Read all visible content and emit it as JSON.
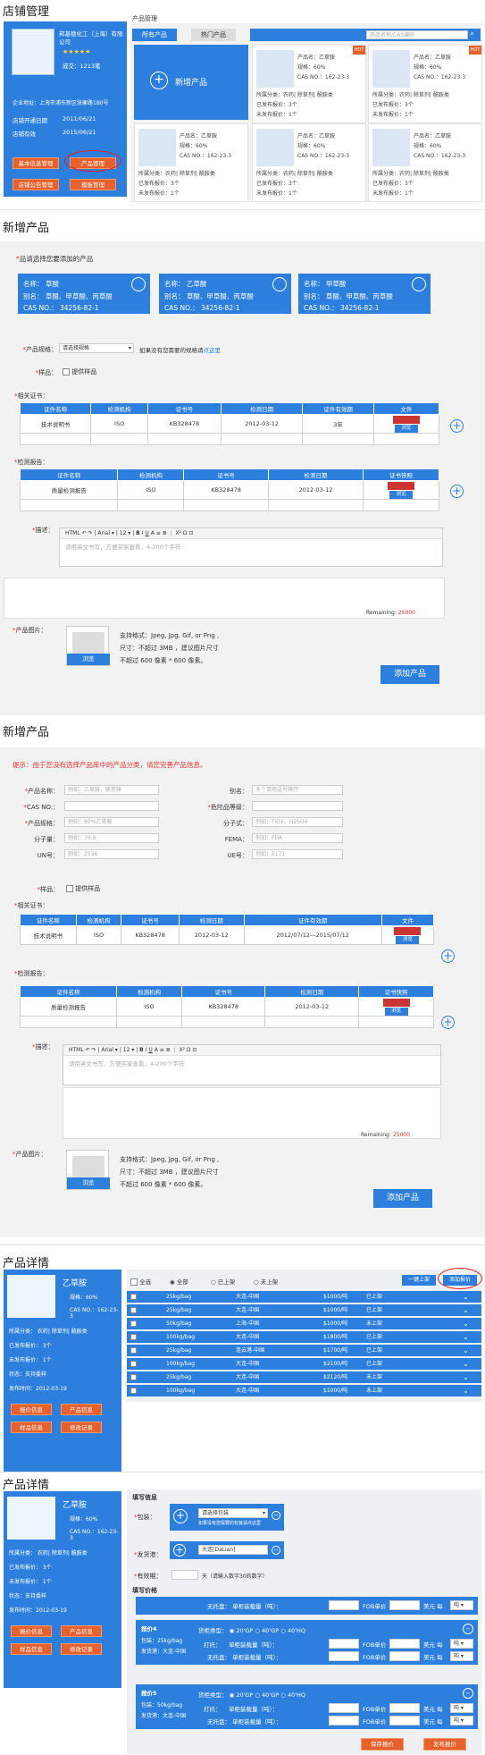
{
  "store": {
    "title": "店铺管理",
    "company": "邦基德化工（上海）有限公司",
    "stars": "★★★★★",
    "deals": "成交：1213笔",
    "address": "企业地址：上海市浦东新区张衡路180号",
    "open_label": "店铺开通日期",
    "open_date": "2011/06/21",
    "expire_label": "店铺有效",
    "expire_date": "2015/06/21",
    "btn_basic": "基本信息管理",
    "btn_product": "产品管理",
    "btn_notice": "店铺公告管理",
    "btn_template": "模板管理"
  },
  "product_mgmt": {
    "title": "产品管理",
    "tab_all": "所有产品",
    "tab_hot": "热门产品",
    "search_placeholder": "商品名称/CAS编码",
    "add_label": "新增产品",
    "hot": "HOT",
    "items": [
      {
        "name": "产品名：乙草胺",
        "spec": "规格：60%",
        "cas": "CAS NO.：162-23-3",
        "cat": "所属分类：农药| 除草剂| 酰胺类",
        "pub": "已发布报价：3个",
        "unpub": "未发布报价：1个"
      },
      {
        "name": "产品名：乙草胺",
        "spec": "规格：60%",
        "cas": "CAS NO.：162-23-3",
        "cat": "所属分类：农药| 除草剂| 酰胺类",
        "pub": "已发布报价：3个",
        "unpub": "未发布报价：1个"
      },
      {
        "name": "产品名：乙草胺",
        "spec": "规格：60%",
        "cas": "CAS NO.：162-23-3",
        "cat": "所属分类：农药| 除草剂| 酰胺类",
        "pub": "已发布报价：3个",
        "unpub": "未发布报价：1个"
      },
      {
        "name": "产品名：乙草胺",
        "spec": "规格：60%",
        "cas": "CAS NO.：162-23-3",
        "cat": "所属分类：农药| 除草剂| 酰胺类",
        "pub": "已发布报价：3个",
        "unpub": "未发布报价：1个"
      },
      {
        "name": "产品名：乙草胺",
        "spec": "规格：60%",
        "cas": "CAS NO.：162-23-3",
        "cat": "所属分类：农药| 除草剂| 酰胺类",
        "pub": "已发布报价：3个",
        "unpub": "未发布报价：1个"
      }
    ]
  },
  "new1": {
    "title": "新增产品",
    "choose": "品请选择您要添加的产品",
    "cards": [
      {
        "name": "名称：   草酸",
        "alias": "别名：   草酸、甲草酸、丙草酸",
        "cas": "CAS NO.：  34256-82-1"
      },
      {
        "name": "名称：   乙草酸",
        "alias": "别名：   草酸、甲草酸、丙草酸",
        "cas": "CAS NO.：  34256-82-1"
      },
      {
        "name": "名称：   甲草酸",
        "alias": "别名：   草酸、甲草酸、丙草酸",
        "cas": "CAS NO.：  34256-82-1"
      }
    ],
    "spec_label": "产品规格：",
    "spec_value": "请选择规格",
    "spec_hint": "如果没有您需要的规格请",
    "spec_link": "点这里",
    "sample_label": "样品：",
    "sample_text": "提供样品",
    "cert_label": "相关证书：",
    "report_label": "检测报告：",
    "desc_label": "描述：",
    "desc_placeholder": "请用英文书写，方便买家查看，4-200个字符",
    "remaining_label": "Remaining:",
    "remaining_value": "25000",
    "image_label": "产品图片：",
    "img_hint1": "支持格式：Jpeg, Jpg, Gif, or Png ,",
    "img_hint2": "尺寸：不超过 3MB ，建议图片尺寸",
    "img_hint3": "不超过 600 像素 * 600 像素。",
    "browse": "浏览",
    "add_btn": "添加产品"
  },
  "cert_table": {
    "headers": [
      "证件名称",
      "检测机构",
      "证书号",
      "检测日期",
      "证件有效期",
      "文件"
    ],
    "row": [
      "技术说明书",
      "ISO",
      "KB328478",
      "2012-03-12",
      "3年",
      ""
    ],
    "browse": "浏览"
  },
  "report_table": {
    "headers": [
      "证件名称",
      "检测机构",
      "证书号",
      "检测日期",
      "证书快照"
    ],
    "row": [
      "质量检测报告",
      "ISO",
      "KB328478",
      "2012-03-12",
      ""
    ],
    "browse": "浏览"
  },
  "editor": {
    "font": "Arial",
    "size": "12"
  },
  "new2": {
    "title": "新增产品",
    "tip": "提示：由于您没有选择产品库中的产品分类，请您完善产品信息。",
    "fields": [
      {
        "label": "产品名称：",
        "ph": "例如：乙草胺，联苯肼"
      },
      {
        "label": "CAS NO.：",
        "ph": ""
      },
      {
        "label": "产品规格：",
        "ph": "例如：80%乙草胺"
      },
      {
        "label": "分子量：",
        "ph": "例如：79.9"
      },
      {
        "label": "UN号：",
        "ph": "例如：2536"
      }
    ],
    "fields_r": [
      {
        "label": "别名：",
        "ph": "多个请用逗号隔开"
      },
      {
        "label": "危险品等级：",
        "ph": ""
      },
      {
        "label": "分子式：",
        "ph": "例如：TiO2、H2SO4"
      },
      {
        "label": "FEMA：",
        "ph": "例如：FDA"
      },
      {
        "label": "UE号：",
        "ph": "例如：E171"
      }
    ],
    "cert_validity": "2012/07/12—2015/07/12"
  },
  "detail1": {
    "title": "产品详情",
    "name": "乙草胺",
    "spec": "规格：60%",
    "cas": "CAS NO.：162-23-3",
    "cat": "所属分类：    农药| 除草剂| 酰胺类",
    "pub": "已发布报价：    3个",
    "unpub": "未发布报价：    1个",
    "status": "状态：支持委样",
    "date": "发布时间：2012-03-19",
    "btn1": "报价信息",
    "btn2": "产品信息",
    "btn3": "样品信息",
    "btn4": "修改记录",
    "filter_all": "全选",
    "f1": "全部",
    "f2": "已上架",
    "f3": "未上架",
    "onekey": "一键上架",
    "addquote": "添加报价",
    "rows": [
      {
        "pkg": "25kg/bag",
        "loc": "大连-中国",
        "price": "$1000/吨",
        "st": "已上架"
      },
      {
        "pkg": "25kg/bag",
        "loc": "大连-中国",
        "price": "$1000/吨",
        "st": "已上架"
      },
      {
        "pkg": "50kg/bag",
        "loc": "上海-中国",
        "price": "$1000/吨",
        "st": "未上架"
      },
      {
        "pkg": "100kg/bag",
        "loc": "大连-中国",
        "price": "$1800/吨",
        "st": "已上架"
      },
      {
        "pkg": "25kg/bag",
        "loc": "连云港-中国",
        "price": "$1700/吨",
        "st": "已上架"
      },
      {
        "pkg": "100kg/bag",
        "loc": "大连-中国",
        "price": "$2100/吨",
        "st": "已上架"
      },
      {
        "pkg": "25kg/bag",
        "loc": "大连-中国",
        "price": "$2120/吨",
        "st": "未上架"
      },
      {
        "pkg": "100kg/bag",
        "loc": "大连-中国",
        "price": "$1000/吨",
        "st": "未上架"
      }
    ]
  },
  "detail2": {
    "title": "产品详情",
    "section": "填写信息",
    "pkg_label": "包装：",
    "pkg_value": "请选择包装",
    "pkg_hint": "如果没有您需要的包装请点这里",
    "port_label": "发货港：",
    "port_value": "大连[DaLian]",
    "valid_label": "有效期：",
    "valid_unit": "天（请输入数字30的数字）",
    "price_section": "填写价格",
    "no_pallet": "无托盘：",
    "unit_price": "单柜装载量（吨）：",
    "fob": "FOB单价",
    "usd": "美元",
    "per": "每",
    "ton": "吨",
    "quotes": [
      {
        "title": "报价4",
        "pack": "包装：25kg/bag",
        "port": "发货港：大连-中国"
      },
      {
        "title": "报价5",
        "pack": "包装：50kg/bag",
        "port": "发货港：大连-中国"
      }
    ],
    "cabinet": "货柜类型：",
    "c20": "20'GP",
    "c40": "40'GP",
    "c40hq": "40'HQ",
    "pallet": "打托：",
    "save": "保存报价",
    "publish": "发布报价"
  }
}
